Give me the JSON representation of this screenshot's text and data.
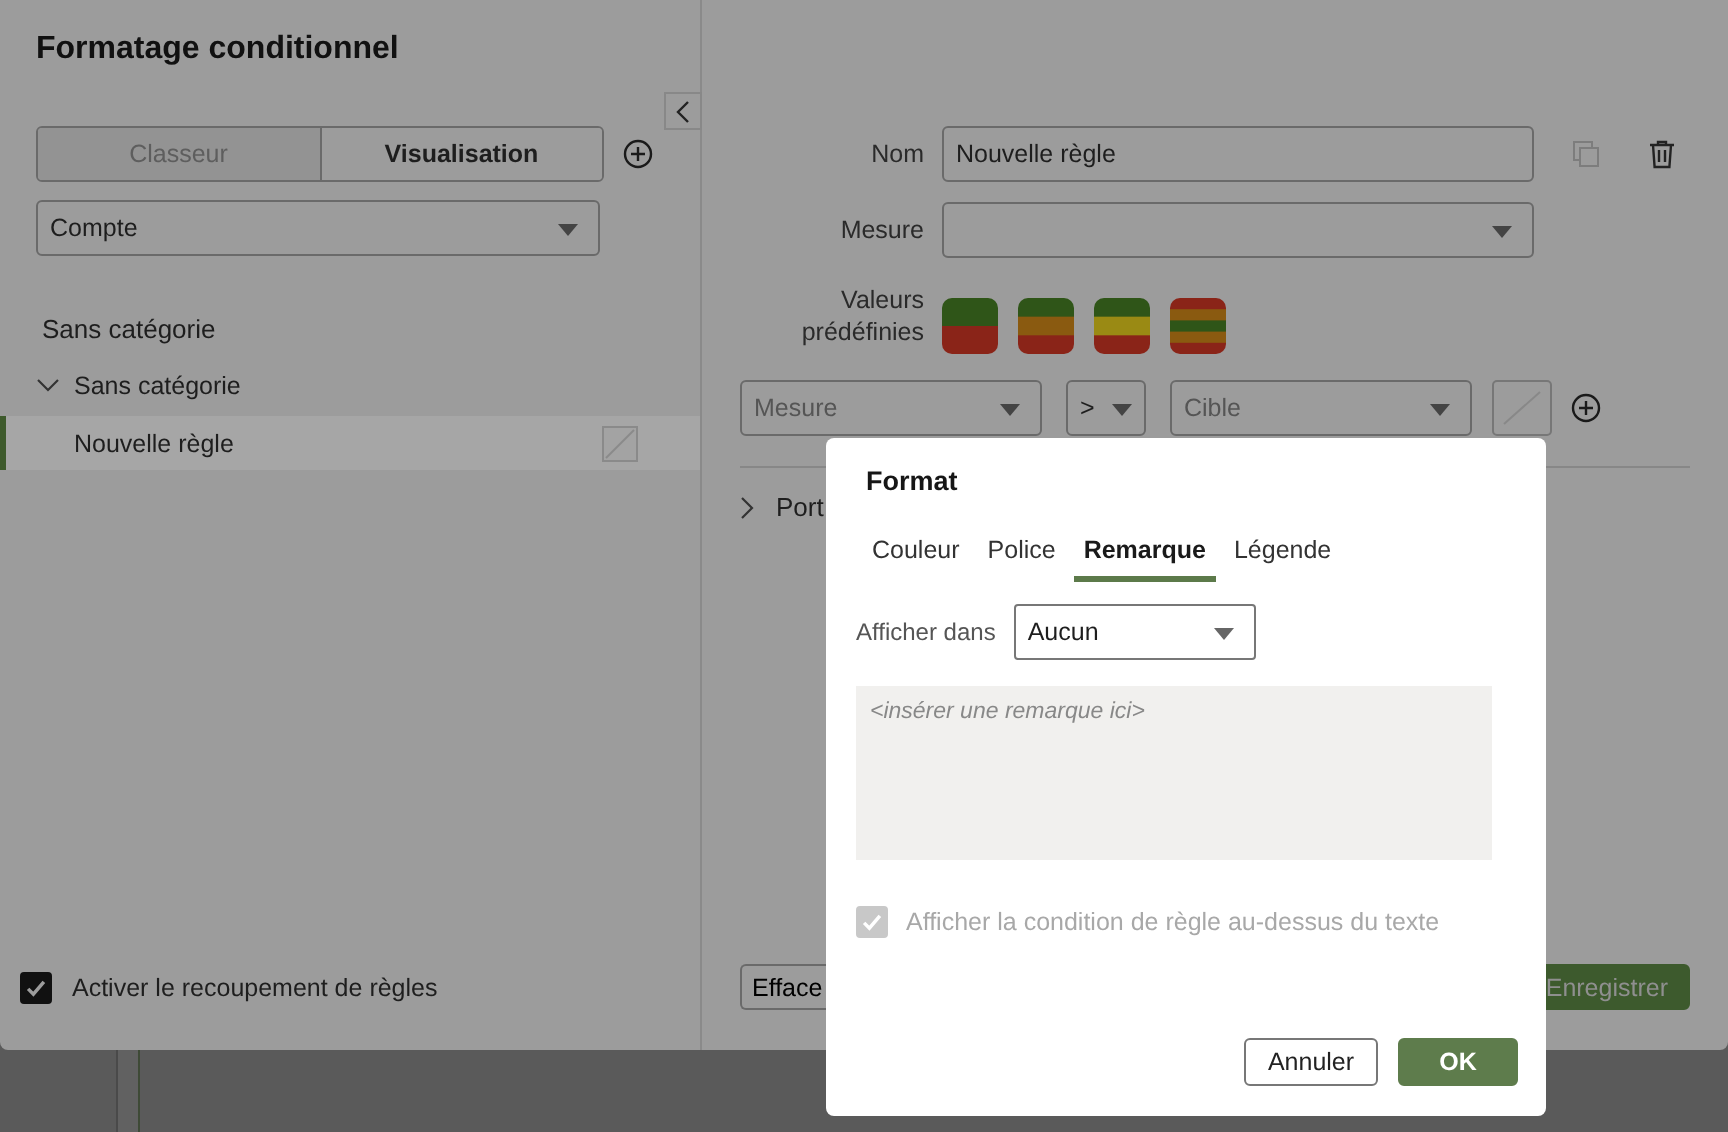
{
  "dialog": {
    "title": "Formatage conditionnel"
  },
  "scope_tabs": [
    {
      "label": "Classeur",
      "selected": false,
      "disabled": true
    },
    {
      "label": "Visualisation",
      "selected": true,
      "disabled": false
    }
  ],
  "measure_select": {
    "value": "Compte"
  },
  "category_heading": "Sans catégorie",
  "tree": [
    {
      "label": "Sans catégorie",
      "expanded": true,
      "children": [
        {
          "label": "Nouvelle règle",
          "selected": true
        }
      ]
    }
  ],
  "overlap_checkbox": {
    "label": "Activer le recoupement de règles",
    "checked": true
  },
  "rule": {
    "name_label": "Nom",
    "name_value": "Nouvelle règle",
    "measure_label": "Mesure",
    "presets_label": "Valeurs prédéfinies",
    "condition": {
      "measure_placeholder": "Mesure",
      "operator": ">",
      "target_placeholder": "Cible"
    },
    "section": "Port"
  },
  "footer_buttons": [
    {
      "label": "Efface",
      "kind": "secondary"
    },
    {
      "label": "Enregistrer",
      "kind": "primary"
    }
  ],
  "format_popover": {
    "title": "Format",
    "tabs": [
      {
        "label": "Couleur",
        "selected": false
      },
      {
        "label": "Police",
        "selected": false
      },
      {
        "label": "Remarque",
        "selected": true
      },
      {
        "label": "Légende",
        "selected": false
      }
    ],
    "show_in_label": "Afficher dans",
    "show_in_value": "Aucun",
    "note_placeholder": "<insérer une remarque ici>",
    "show_condition": {
      "label": "Afficher la condition de règle au-dessus du texte",
      "checked": true,
      "disabled": true
    },
    "buttons": [
      {
        "label": "Annuler",
        "kind": "secondary"
      },
      {
        "label": "OK",
        "kind": "primary"
      }
    ]
  }
}
